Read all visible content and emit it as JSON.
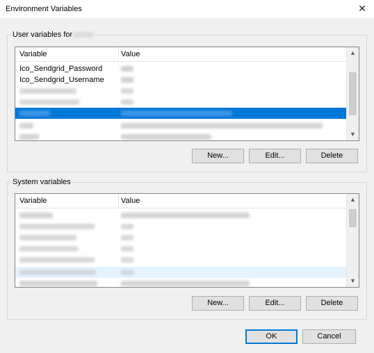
{
  "window": {
    "title": "Environment Variables"
  },
  "user_section": {
    "label": "User variables for",
    "headers": {
      "variable": "Variable",
      "value": "Value"
    },
    "rows": [
      {
        "variable": "Ico_Sendgrid_Password",
        "value": ""
      },
      {
        "variable": "Ico_Sendgrid_Username",
        "value": ""
      }
    ],
    "buttons": {
      "new": "New...",
      "edit": "Edit...",
      "delete": "Delete"
    }
  },
  "system_section": {
    "label": "System variables",
    "headers": {
      "variable": "Variable",
      "value": "Value"
    },
    "buttons": {
      "new": "New...",
      "edit": "Edit...",
      "delete": "Delete"
    }
  },
  "footer": {
    "ok": "OK",
    "cancel": "Cancel"
  },
  "icons": {
    "close": "close-icon",
    "scroll_up": "chevron-up-icon",
    "scroll_down": "chevron-down-icon"
  },
  "colors": {
    "selection": "#0078d7",
    "button_face": "#e1e1e1",
    "default_border": "#0078d7"
  }
}
